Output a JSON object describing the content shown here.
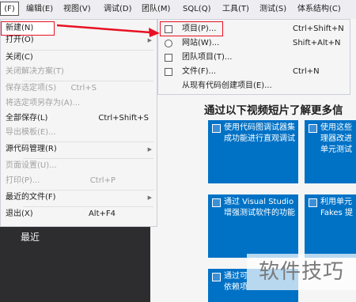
{
  "menubar": {
    "file": "(F)",
    "items": [
      "编辑(E)",
      "视图(V)",
      "调试(D)",
      "团队(M)",
      "SQL(Q)",
      "工具(T)",
      "测试(S)",
      "体系结构(C)"
    ]
  },
  "file_menu": [
    {
      "label": "新建(N)",
      "shortcut": "",
      "disabled": false
    },
    {
      "label": "打开(O)",
      "shortcut": "",
      "disabled": false
    },
    {
      "label": "关闭(C)",
      "shortcut": "",
      "disabled": false
    },
    {
      "label": "关闭解决方案(T)",
      "shortcut": "",
      "disabled": true
    },
    {
      "label": "保存选定项(S)",
      "shortcut": "Ctrl+S",
      "disabled": true
    },
    {
      "label": "将选定项另存为(A)...",
      "shortcut": "",
      "disabled": true
    },
    {
      "label": "全部保存(L)",
      "shortcut": "Ctrl+Shift+S",
      "disabled": false
    },
    {
      "label": "导出模板(E)...",
      "shortcut": "",
      "disabled": true
    },
    {
      "label": "源代码管理(R)",
      "shortcut": "",
      "disabled": false
    },
    {
      "label": "页面设置(U)...",
      "shortcut": "",
      "disabled": true
    },
    {
      "label": "打印(P)...",
      "shortcut": "Ctrl+P",
      "disabled": true
    },
    {
      "label": "最近的文件(F)",
      "shortcut": "",
      "disabled": false
    },
    {
      "label": "退出(X)",
      "shortcut": "Alt+F4",
      "disabled": false
    }
  ],
  "new_submenu": [
    {
      "label": "项目(P)...",
      "shortcut": "Ctrl+Shift+N",
      "icon": "project-icon"
    },
    {
      "label": "网站(W)...",
      "shortcut": "Shift+Alt+N",
      "icon": "website-icon"
    },
    {
      "label": "团队项目(T)...",
      "shortcut": "",
      "icon": "team-project-icon"
    },
    {
      "label": "文件(F)...",
      "shortcut": "Ctrl+N",
      "icon": "file-icon"
    },
    {
      "label": "从现有代码创建项目(E)...",
      "shortcut": "",
      "icon": ""
    }
  ],
  "start_page": {
    "heading": "通过以下视频短片了解更多信",
    "tiles": [
      "使用代码图调试器集\n成功能进行直观调试",
      "使用这些\n理器改进\n单元测试",
      "通过 Visual Studio\n增强测试软件的功能",
      "利用单元\nFakes 提",
      "通过可\n依赖项"
    ]
  },
  "recent_label": "最近",
  "watermark": "软件技巧",
  "colors": {
    "accent": "#0072c6",
    "highlight": "#e81123",
    "menu_bg": "#f5f5f5",
    "ide_dark": "#2d2d30"
  }
}
